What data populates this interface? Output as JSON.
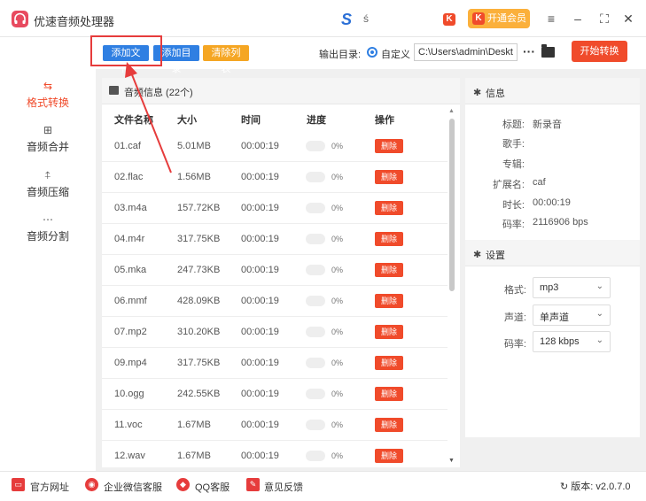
{
  "titlebar": {
    "app_title": "优速音频处理器",
    "vip_label": "开通会员",
    "k_letter": "K",
    "brand_glyph": "S",
    "brand_glyph2": "ś"
  },
  "toolbar": {
    "add_file": "添加文件",
    "add_dir": "添加目录",
    "clear_list": "清除列表",
    "output_label": "输出目录:",
    "custom_label": "自定义",
    "output_path": "C:\\Users\\admin\\Deskto",
    "browse": "···",
    "start": "开始转换"
  },
  "sidebar": {
    "items": [
      {
        "label": "格式转换",
        "icon": "⇆"
      },
      {
        "label": "音频合并",
        "icon": "⊞"
      },
      {
        "label": "音频压缩",
        "icon": "⍏"
      },
      {
        "label": "音频分割",
        "icon": "⋯"
      }
    ]
  },
  "file_list": {
    "title": "音频信息 (22个)",
    "columns": [
      "文件名称",
      "大小",
      "时间",
      "进度",
      "操作"
    ],
    "delete_label": "删除",
    "rows": [
      {
        "name": "01.caf",
        "size": "5.01MB",
        "time": "00:00:19",
        "progress": "0%"
      },
      {
        "name": "02.flac",
        "size": "1.56MB",
        "time": "00:00:19",
        "progress": "0%"
      },
      {
        "name": "03.m4a",
        "size": "157.72KB",
        "time": "00:00:19",
        "progress": "0%"
      },
      {
        "name": "04.m4r",
        "size": "317.75KB",
        "time": "00:00:19",
        "progress": "0%"
      },
      {
        "name": "05.mka",
        "size": "247.73KB",
        "time": "00:00:19",
        "progress": "0%"
      },
      {
        "name": "06.mmf",
        "size": "428.09KB",
        "time": "00:00:19",
        "progress": "0%"
      },
      {
        "name": "07.mp2",
        "size": "310.20KB",
        "time": "00:00:19",
        "progress": "0%"
      },
      {
        "name": "09.mp4",
        "size": "317.75KB",
        "time": "00:00:19",
        "progress": "0%"
      },
      {
        "name": "10.ogg",
        "size": "242.55KB",
        "time": "00:00:19",
        "progress": "0%"
      },
      {
        "name": "11.voc",
        "size": "1.67MB",
        "time": "00:00:19",
        "progress": "0%"
      },
      {
        "name": "12.wav",
        "size": "1.67MB",
        "time": "00:00:19",
        "progress": "0%"
      }
    ]
  },
  "info": {
    "title": "信息",
    "fields": [
      {
        "key": "标题:",
        "value": "新录音"
      },
      {
        "key": "歌手:",
        "value": ""
      },
      {
        "key": "专辑:",
        "value": ""
      },
      {
        "key": "扩展名:",
        "value": "caf"
      },
      {
        "key": "时长:",
        "value": "00:00:19"
      },
      {
        "key": "码率:",
        "value": "2116906 bps"
      }
    ]
  },
  "settings": {
    "title": "设置",
    "fields": [
      {
        "label": "格式:",
        "value": "mp3"
      },
      {
        "label": "声道:",
        "value": "单声道"
      },
      {
        "label": "码率:",
        "value": "128 kbps"
      }
    ]
  },
  "footer": {
    "website": "官方网址",
    "wechat": "企业微信客服",
    "qq": "QQ客服",
    "feedback": "意见反馈",
    "version": "版本: v2.0.7.0"
  },
  "colors": {
    "accent": "#f04b2b",
    "primary": "#2f7fe2",
    "orange": "#f5a623",
    "annotation": "#e63c3c"
  }
}
